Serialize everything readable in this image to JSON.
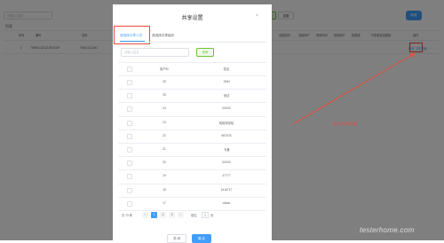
{
  "background": {
    "search_placeholder": "请输入名称",
    "search_button": "查询",
    "reset_button": "重置",
    "add_button": "新增",
    "tab": "列表",
    "columns": [
      "序号",
      "编号",
      "名称",
      "类型",
      "创建时间",
      "创建用户",
      "修改时间",
      "修改用户",
      "权限组",
      "可查看信息模板",
      "操作"
    ],
    "row": {
      "index": "1",
      "code": "TMINO-1101Z1NOZ1M",
      "name": "TMN-01Z1NO",
      "type": "",
      "created_at": "",
      "created_by": "",
      "updated_at": "",
      "updated_by": "",
      "group": "",
      "template": "",
      "action_edit": "修改",
      "action_share": "共享设置",
      "more": "..."
    }
  },
  "modal": {
    "title": "共享设置",
    "close_icon": "close-icon",
    "tabs": [
      "请选择共享人员",
      "请选择共享组织"
    ],
    "active_tab": 0,
    "search_placeholder": "请输入姓名",
    "search_button": "查询",
    "columns": [
      "",
      "用户ID",
      "姓名"
    ],
    "rows": [
      {
        "id": "25",
        "name": "1Mirt"
      },
      {
        "id": "25",
        "name": "测试"
      },
      {
        "id": "24",
        "name": "00002"
      },
      {
        "id": "23",
        "name": "哈哈哈哈哈"
      },
      {
        "id": "22",
        "name": "987678"
      },
      {
        "id": "21",
        "name": "卡通"
      },
      {
        "id": "20",
        "name": "00000"
      },
      {
        "id": "19",
        "name": "47777"
      },
      {
        "id": "18",
        "name": "1416717"
      },
      {
        "id": "17",
        "name": "cation"
      }
    ],
    "pagination": {
      "total_label": "共 73 条",
      "pages": [
        "1",
        "2",
        "3"
      ],
      "current": "1",
      "goto_label": "前往",
      "goto_value": "1",
      "page_suffix": "页"
    },
    "cancel_button": "关 闭",
    "ok_button": "确 定"
  },
  "annotation": {
    "text": "进入共享设置"
  },
  "watermark": "testerhome.com",
  "colors": {
    "primary": "#409eff",
    "success": "#67c23a",
    "annotation": "#e74c3c"
  }
}
